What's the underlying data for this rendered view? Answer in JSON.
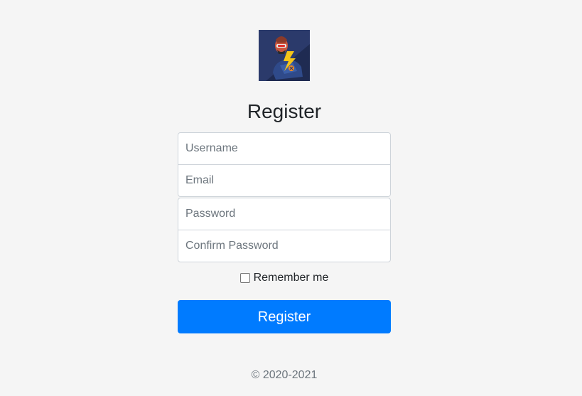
{
  "form": {
    "title": "Register",
    "username_placeholder": "Username",
    "email_placeholder": "Email",
    "password_placeholder": "Password",
    "confirm_password_placeholder": "Confirm Password",
    "remember_label": "Remember me",
    "remember_checked": false,
    "submit_label": "Register"
  },
  "footer": {
    "copyright": "© 2020-2021"
  },
  "icons": {
    "logo": "hero-avatar-logo"
  },
  "colors": {
    "background": "#f5f5f5",
    "primary": "#007bff",
    "logo_bg": "#2b3a6b"
  }
}
